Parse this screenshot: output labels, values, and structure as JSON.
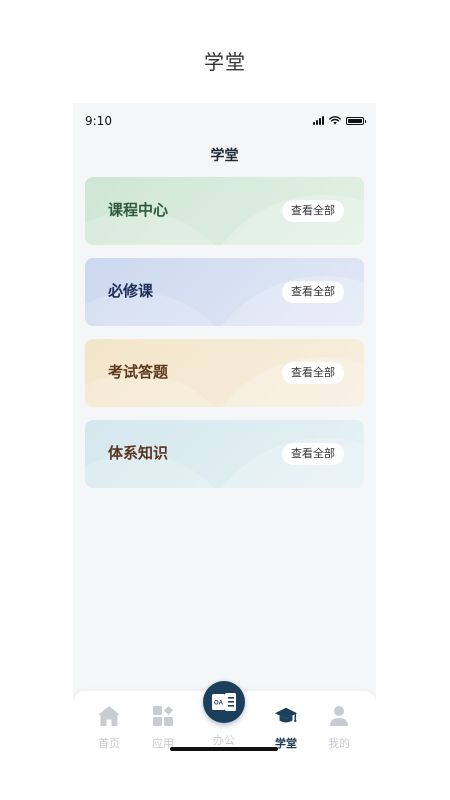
{
  "page_title": "学堂",
  "status_bar": {
    "time": "9:10"
  },
  "header": {
    "title": "学堂"
  },
  "cards": [
    {
      "title": "课程中心",
      "action": "查看全部"
    },
    {
      "title": "必修课",
      "action": "查看全部"
    },
    {
      "title": "考试答题",
      "action": "查看全部"
    },
    {
      "title": "体系知识",
      "action": "查看全部"
    }
  ],
  "tabbar": {
    "items": [
      {
        "label": "首页",
        "icon": "home-icon"
      },
      {
        "label": "应用",
        "icon": "apps-icon"
      },
      {
        "label": "办公",
        "icon": "oa-document-icon",
        "icon_text": "OA"
      },
      {
        "label": "学堂",
        "icon": "graduation-cap-icon"
      },
      {
        "label": "我的",
        "icon": "user-icon"
      }
    ],
    "active_index": 3
  },
  "colors": {
    "accent": "#1c3f5c",
    "inactive": "#c8cbd1",
    "background": "#f5f6f8"
  }
}
